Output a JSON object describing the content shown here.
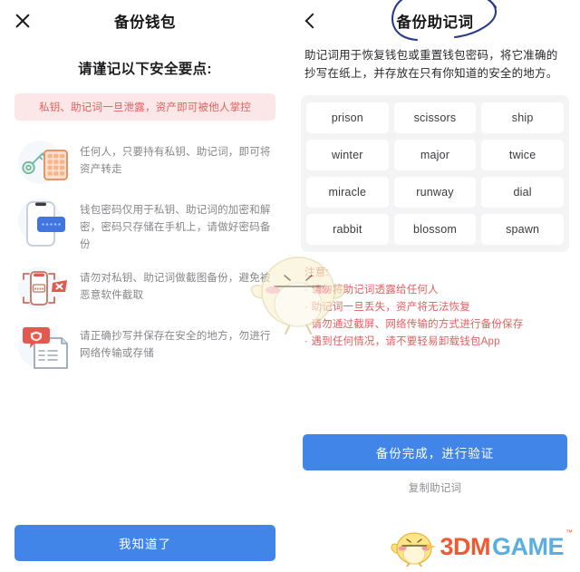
{
  "left": {
    "topbar": {
      "close_icon": "close-icon",
      "title": "备份钱包"
    },
    "heading": "请谨记以下安全要点:",
    "banner": "私钥、助记词一旦泄露，资产即可被他人掌控",
    "items": [
      {
        "icon": "key-and-card-icon",
        "text": "任何人，只要持有私钥、助记词，即可将资产转走"
      },
      {
        "icon": "phone-password-icon",
        "text": "钱包密码仅用于私钥、助记词的加密和解密，密码只存储在手机上，请做好密码备份"
      },
      {
        "icon": "no-screenshot-icon",
        "text": "请勿对私钥、助记词做截图备份，避免被恶意软件截取"
      },
      {
        "icon": "secure-document-icon",
        "text": "请正确抄写并保存在安全的地方，勿进行网络传输或存储"
      }
    ],
    "primary_button": "我知道了"
  },
  "right": {
    "topbar": {
      "back_icon": "back-arrow-icon",
      "title": "备份助记词"
    },
    "annotation": {
      "shape": "hand-drawn-ellipse",
      "color": "#2a3a8c"
    },
    "description": "助记词用于恢复钱包或重置钱包密码，将它准确的抄写在纸上，并存放在只有你知道的安全的地方。",
    "mnemonic_words": [
      "prison",
      "scissors",
      "ship",
      "winter",
      "major",
      "twice",
      "miracle",
      "runway",
      "dial",
      "rabbit",
      "blossom",
      "spawn"
    ],
    "notes_title": "注意:",
    "notes": [
      "请勿将助记词透露给任何人",
      "助记词一旦丢失，资产将无法恢复",
      "请勿通过截屏、网络传输的方式进行备份保存",
      "遇到任何情况，请不要轻易卸载钱包App"
    ],
    "primary_button": "备份完成，进行验证",
    "copy_link": "复制助记词"
  },
  "overlay": {
    "mascot": "chick-mascot-watermark",
    "watermark_3dm": "3DM",
    "watermark_game": "GAME",
    "watermark_tm": "™"
  },
  "colors": {
    "primary_blue": "#4285e8",
    "warning_red": "#e2605f",
    "banner_pink": "#fbe7e7",
    "grid_gray": "#f4f4f6",
    "body_gray": "#86868c",
    "annotation_blue": "#2a3a8c",
    "wm_orange": "#ef5a32",
    "wm_blue": "#5aaee0"
  }
}
